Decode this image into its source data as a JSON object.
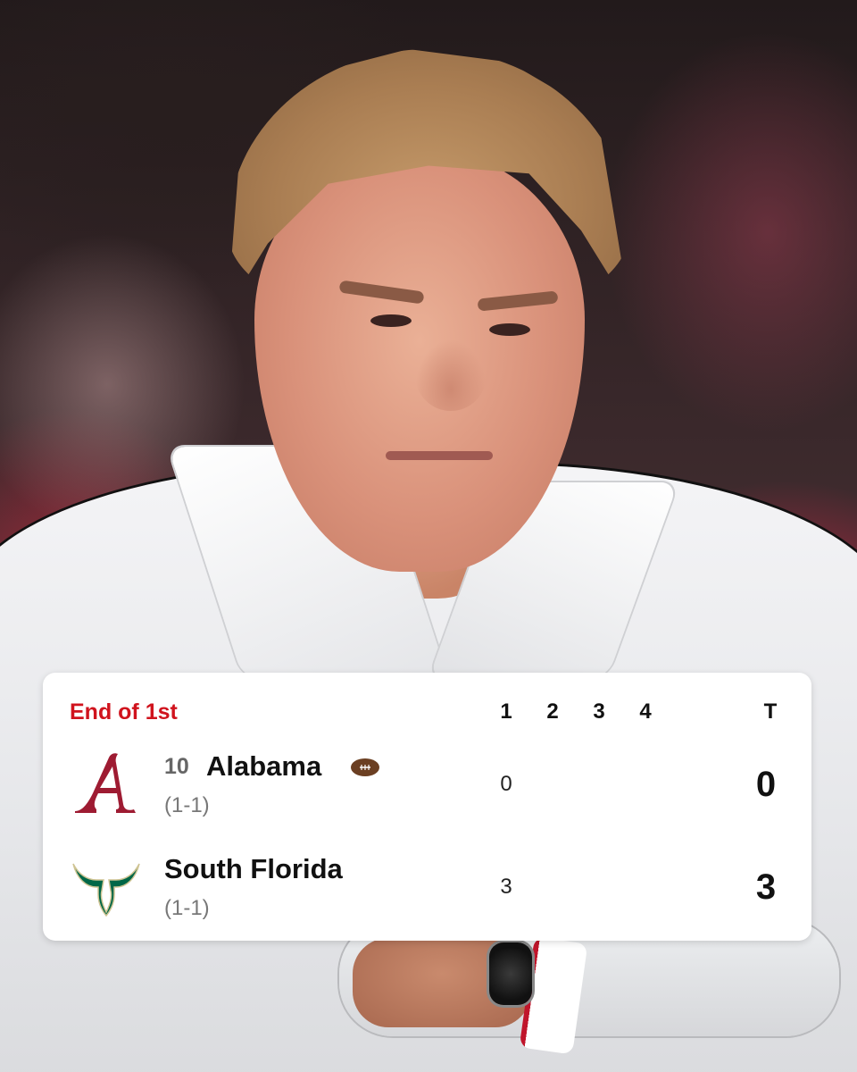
{
  "scorecard": {
    "status": "End of 1st",
    "columns": [
      "1",
      "2",
      "3",
      "4",
      "T"
    ],
    "teams": [
      {
        "rank": "10",
        "name": "Alabama",
        "record": "(1-1)",
        "quarters": [
          "0"
        ],
        "total": "0",
        "possession": true,
        "logo_icon": "alabama-script-a-logo",
        "logo_color": "#9e1b32"
      },
      {
        "rank": "",
        "name": "South Florida",
        "record": "(1-1)",
        "quarters": [
          "3"
        ],
        "total": "3",
        "possession": false,
        "logo_icon": "usf-bull-horns-logo",
        "logo_color": "#006747"
      }
    ]
  },
  "colors": {
    "status_red": "#d0131d",
    "card_bg": "#ffffff"
  }
}
